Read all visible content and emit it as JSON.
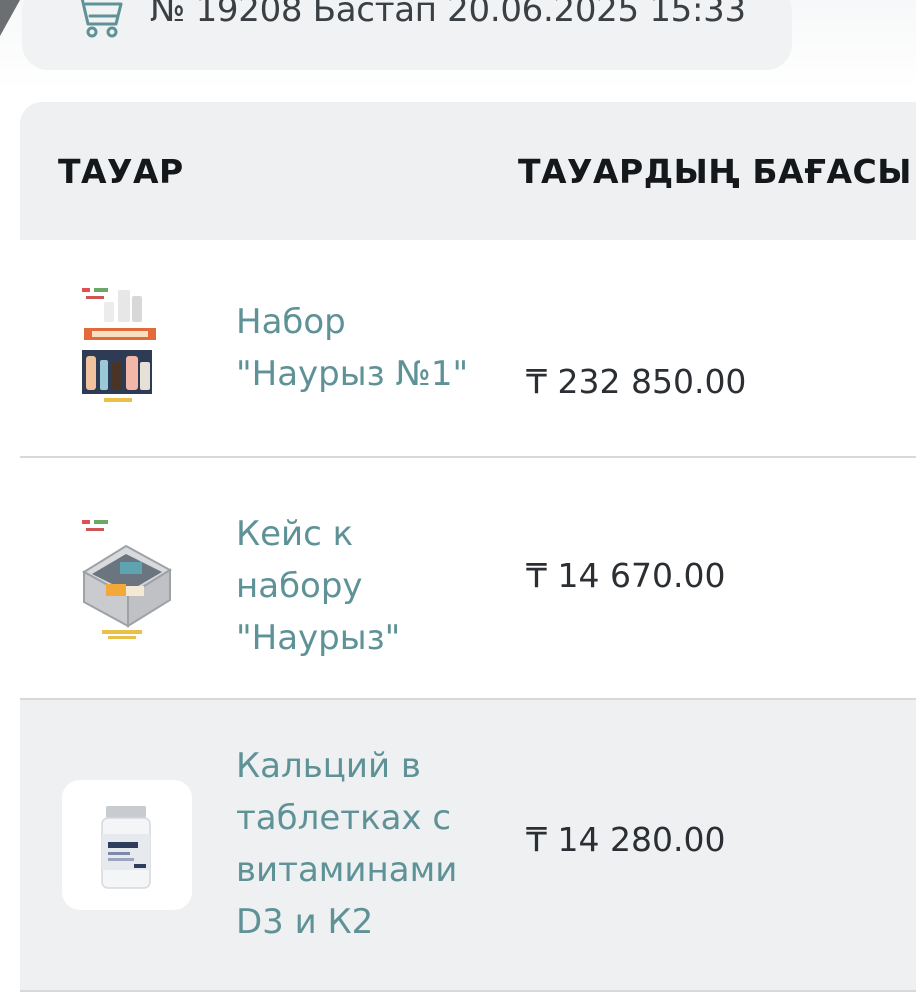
{
  "order": {
    "header_text": "№ 19208 Бастап 20.06.2025 15:33",
    "icon": "cart-icon"
  },
  "table": {
    "columns": {
      "product": "ТАУАР",
      "price": "ТАУАРДЫҢ БАҒАСЫ"
    },
    "rows": [
      {
        "name": "Набор \"Наурыз №1\"",
        "price": "₸ 232 850.00",
        "thumb_icon": "product-set-image"
      },
      {
        "name": "Кейс к набору \"Наурыз\"",
        "price": "₸ 14 670.00",
        "thumb_icon": "product-case-image"
      },
      {
        "name": "Кальций в таблетках с витаминами D3 и К2",
        "price": "₸ 14 280.00",
        "thumb_icon": "product-bottle-image"
      }
    ]
  }
}
